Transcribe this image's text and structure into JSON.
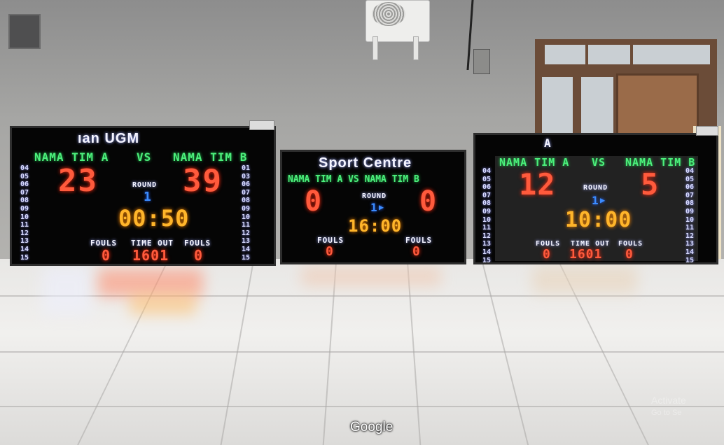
{
  "scene": {
    "google_logo": "Google",
    "watermark_line1": "Activate",
    "watermark_line2": "Go to Se"
  },
  "board_left": {
    "title": "ıan UGM",
    "team_a": "NAMA TIM A",
    "vs": "VS",
    "team_b": "NAMA TIM B",
    "score_a": "23",
    "score_b": "39",
    "round_label": "ROUND",
    "round_value": "1",
    "clock": "00:50",
    "fouls_a_label": "FOULS",
    "fouls_a": "0",
    "timeout_label": "TIME OUT",
    "timeout_value": "1601",
    "fouls_b_label": "FOULS",
    "fouls_b": "0",
    "left_numbers": [
      "04",
      "05",
      "06",
      "07",
      "08",
      "09",
      "10",
      "11",
      "12",
      "13",
      "14",
      "15"
    ],
    "right_numbers": [
      "01",
      "03",
      "06",
      "07",
      "08",
      "09",
      "10",
      "11",
      "12",
      "13",
      "14",
      "15"
    ]
  },
  "board_center": {
    "title": "Sport Centre",
    "teams_line": "NAMA TIM A VS NAMA TIM B",
    "score_a": "0",
    "score_b": "0",
    "round_label": "ROUND",
    "round_value": "1",
    "clock": "16:00",
    "fouls_a_label": "FOULS",
    "fouls_a": "0",
    "fouls_b_label": "FOULS",
    "fouls_b": "0"
  },
  "board_right": {
    "title": "A",
    "team_a": "NAMA TIM A",
    "vs": "VS",
    "team_b": "NAMA TIM B",
    "score_a": "12",
    "score_b": "5",
    "round_label": "ROUND",
    "round_value": "1",
    "clock": "10:00",
    "fouls_a_label": "FOULS",
    "fouls_a": "0",
    "timeout_label": "TIME OUT",
    "timeout_value": "1601",
    "fouls_b_label": "FOULS",
    "fouls_b": "0",
    "left_numbers": [
      "04",
      "05",
      "06",
      "07",
      "08",
      "09",
      "10",
      "11",
      "12",
      "13",
      "14",
      "15"
    ],
    "right_numbers": [
      "04",
      "05",
      "06",
      "07",
      "08",
      "09",
      "10",
      "11",
      "12",
      "13",
      "14",
      "15"
    ]
  }
}
